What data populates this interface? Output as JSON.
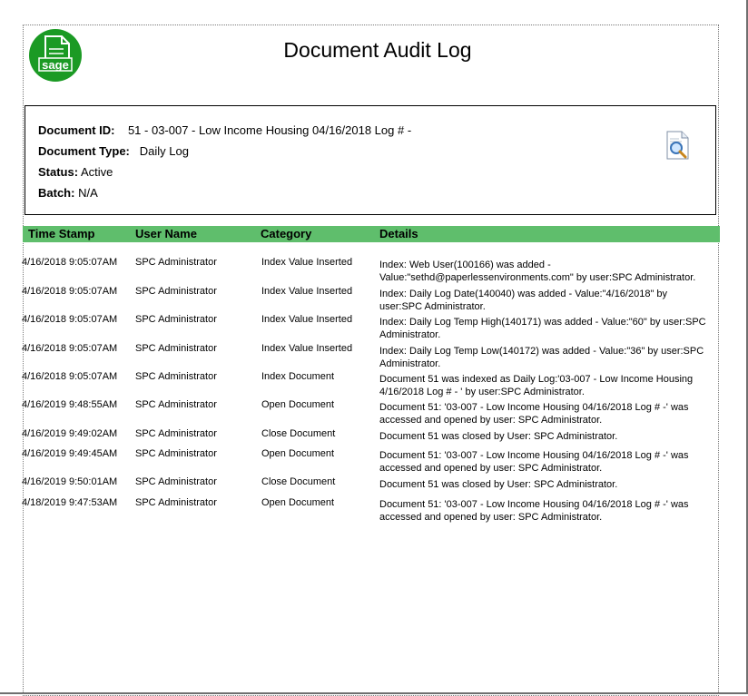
{
  "report": {
    "title": "Document Audit Log",
    "logo_text": "sage"
  },
  "document": {
    "id_label": "Document ID:",
    "id_value": "51  -  03-007 - Low Income Housing 04/16/2018 Log # -",
    "type_label": "Document Type:",
    "type_value": "Daily Log",
    "status_label": "Status:",
    "status_value": "Active",
    "batch_label": "Batch:",
    "batch_value": "N/A"
  },
  "columns": [
    "Time Stamp",
    "User Name",
    "Category",
    "Details"
  ],
  "colors": {
    "header_bar": "#5fbe6c",
    "logo": "#1b9a24"
  },
  "icons": {
    "logo": "sage-logo-icon",
    "preview": "document-search-icon"
  },
  "rows": [
    {
      "time": "4/16/2018   9:05:07AM",
      "user": "SPC Administrator",
      "category": "Index Value Inserted",
      "details": "Index: Web User(100166) was added - Value:\"sethd@paperlessenvironments.com\" by user:SPC Administrator."
    },
    {
      "time": "4/16/2018   9:05:07AM",
      "user": "SPC Administrator",
      "category": "Index Value Inserted",
      "details": "Index: Daily Log Date(140040) was added - Value:\"4/16/2018\" by user:SPC Administrator."
    },
    {
      "time": "4/16/2018   9:05:07AM",
      "user": "SPC Administrator",
      "category": "Index Value Inserted",
      "details": "Index: Daily Log Temp High(140171) was added - Value:\"60\" by user:SPC Administrator."
    },
    {
      "time": "4/16/2018   9:05:07AM",
      "user": "SPC Administrator",
      "category": "Index Value Inserted",
      "details": "Index: Daily Log Temp Low(140172) was added - Value:\"36\" by user:SPC Administrator."
    },
    {
      "time": "4/16/2018   9:05:07AM",
      "user": "SPC Administrator",
      "category": "Index Document",
      "details": "Document 51 was indexed as Daily Log:'03-007 - Low Income Housing 4/16/2018 Log # - '  by user:SPC Administrator."
    },
    {
      "time": "4/16/2019   9:48:55AM",
      "user": "SPC Administrator",
      "category": "Open Document",
      "details": "Document 51: '03-007 - Low Income Housing 04/16/2018 Log # -' was accessed and opened by user:  SPC Administrator."
    },
    {
      "time": "4/16/2019   9:49:02AM",
      "user": "SPC Administrator",
      "category": "Close Document",
      "details": "Document 51 was closed by User: SPC Administrator."
    },
    {
      "time": "4/16/2019   9:49:45AM",
      "user": "SPC Administrator",
      "category": "Open Document",
      "details": "Document 51: '03-007 - Low Income Housing 04/16/2018 Log # -' was accessed and opened by user:  SPC Administrator."
    },
    {
      "time": "4/16/2019   9:50:01AM",
      "user": "SPC Administrator",
      "category": "Close Document",
      "details": "Document 51 was closed by User: SPC Administrator."
    },
    {
      "time": "4/18/2019   9:47:53AM",
      "user": "SPC Administrator",
      "category": "Open Document",
      "details": "Document 51: '03-007 - Low Income Housing 04/16/2018 Log # -' was accessed and opened by user:  SPC Administrator."
    }
  ]
}
